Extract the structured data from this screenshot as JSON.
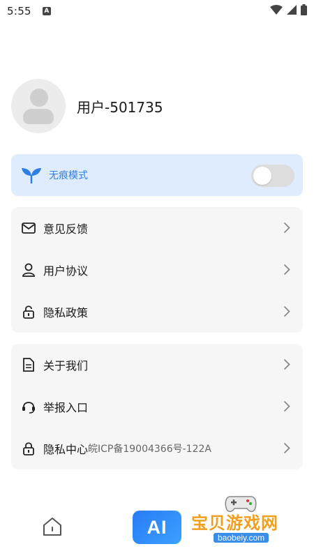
{
  "status_bar": {
    "time": "5:55",
    "notification_letter": "A"
  },
  "profile": {
    "username": "用户-501735"
  },
  "incognito": {
    "label": "无痕模式",
    "enabled": false,
    "accent": "#2f7fe0",
    "background": "#deecfd"
  },
  "menu_group_1": [
    {
      "label": "意见反馈",
      "icon": "mail-icon"
    },
    {
      "label": "用户协议",
      "icon": "user-icon"
    },
    {
      "label": "隐私政策",
      "icon": "lock-icon"
    }
  ],
  "menu_group_2": [
    {
      "label": "关于我们",
      "icon": "document-icon"
    },
    {
      "label": "举报入口",
      "icon": "headset-icon"
    },
    {
      "label": "隐私中心",
      "extra": "皖ICP备19004366号-122A",
      "icon": "lock-icon"
    }
  ],
  "bottom_nav": {
    "ai_label": "AI"
  },
  "watermark": {
    "title": "宝贝游戏网",
    "url": "baobeiy.com"
  }
}
